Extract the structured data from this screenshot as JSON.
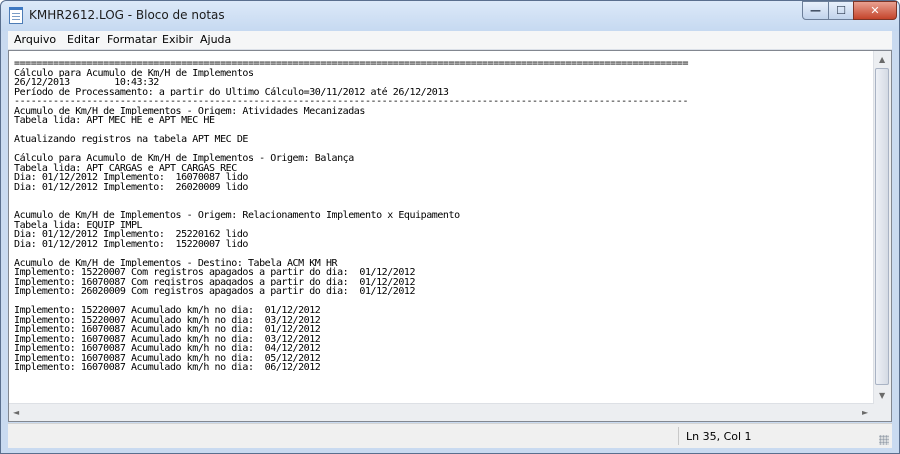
{
  "window": {
    "title": "KMHR2612.LOG - Bloco de notas"
  },
  "titlebar_buttons": {
    "minimize": "—",
    "maximize": "☐",
    "close": "✕"
  },
  "menu": [
    "Arquivo",
    "Editar",
    "Formatar",
    "Exibir",
    "Ajuda"
  ],
  "scrollbar": {
    "up": "▲",
    "down": "▼",
    "left": "◄",
    "right": "►"
  },
  "editor": {
    "lines": [
      "=========================================================================================================================",
      "Cálculo para Acumulo de Km/H de Implementos",
      "26/12/2013        10:43:32",
      "Período de Processamento: a partir do Último Cálculo=30/11/2012 até 26/12/2013",
      "-------------------------------------------------------------------------------------------------------------------------",
      "Acumulo de Km/H de Implementos - Origem: Atividades Mecanizadas",
      "Tabela lida: APT_MEC_HE e APT_MEC_HE",
      "",
      "Atualizando registros na tabela APT_MEC_DE",
      "",
      "Cálculo para Acumulo de Km/H de Implementos - Origem: Balança",
      "Tabela lida: APT_CARGAS e APT_CARGAS_REC",
      "Dia: 01/12/2012 Implemento:  16070087 lido",
      "Dia: 01/12/2012 Implemento:  26020009 lido",
      "",
      "",
      "Acumulo de Km/H de Implementos - Origem: Relacionamento Implemento x Equipamento",
      "Tabela lida: EQUIP_IMPL",
      "Dia: 01/12/2012 Implemento:  25220162 lido",
      "Dia: 01/12/2012 Implemento:  15220007 lido",
      "",
      "Acumulo de Km/H de Implementos - Destino: Tabela ACM_KM_HR",
      "Implemento: 15220007 Com registros apagados a partir do dia:  01/12/2012",
      "Implemento: 16070087 Com registros apagados a partir do dia:  01/12/2012",
      "Implemento: 26020009 Com registros apagados a partir do dia:  01/12/2012",
      "",
      "Implemento: 15220007 Acumulado km/h no dia:  01/12/2012",
      "Implemento: 15220007 Acumulado km/h no dia:  03/12/2012",
      "Implemento: 16070087 Acumulado km/h no dia:  01/12/2012",
      "Implemento: 16070087 Acumulado km/h no dia:  03/12/2012",
      "Implemento: 16070087 Acumulado km/h no dia:  04/12/2012",
      "Implemento: 16070087 Acumulado km/h no dia:  05/12/2012",
      "Implemento: 16070087 Acumulado km/h no dia:  06/12/2012"
    ]
  },
  "status": {
    "position": "Ln 35, Col 1"
  }
}
